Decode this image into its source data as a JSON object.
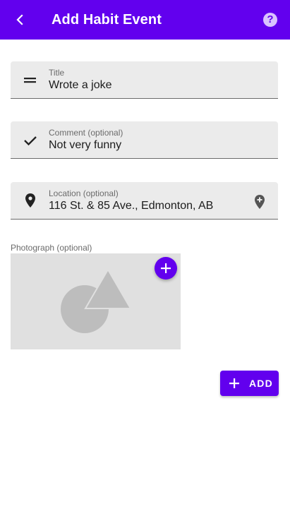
{
  "appbar": {
    "title": "Add Habit Event",
    "back_icon": "arrow-back-icon",
    "help_icon": "help-icon",
    "help_glyph": "?"
  },
  "form": {
    "title_field": {
      "label": "Title",
      "value": "Wrote a joke",
      "icon": "drag-handle-icon"
    },
    "comment_field": {
      "label": "Comment (optional)",
      "value": "Not very funny",
      "icon": "check-icon"
    },
    "location_field": {
      "label": "Location (optional)",
      "value": "116 St. & 85 Ave., Edmonton, AB",
      "icon": "location-pin-icon",
      "trailing_icon": "add-location-icon"
    },
    "photo": {
      "label": "Photograph (optional)",
      "add_icon": "add-photo-icon",
      "placeholder_icon": "shapes-placeholder-icon"
    }
  },
  "actions": {
    "add_label": "ADD",
    "add_icon": "plus-icon"
  },
  "colors": {
    "primary": "#6200ee",
    "field_bg": "#ebebeb",
    "photo_bg": "#e0e0e0"
  }
}
